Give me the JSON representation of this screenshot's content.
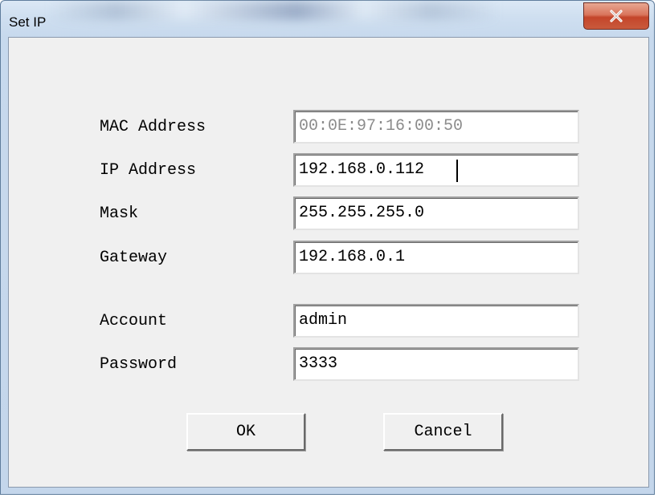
{
  "window": {
    "title": "Set IP",
    "close_label": "x"
  },
  "form": {
    "mac_label": "MAC Address",
    "mac_value": "00:0E:97:16:00:50",
    "ip_label": "IP Address",
    "ip_value": "192.168.0.112",
    "mask_label": "Mask",
    "mask_value": "255.255.255.0",
    "gateway_label": "Gateway",
    "gateway_value": "192.168.0.1",
    "account_label": "Account",
    "account_value": "admin",
    "password_label": "Password",
    "password_value": "3333"
  },
  "buttons": {
    "ok": "OK",
    "cancel": "Cancel"
  },
  "icons": {
    "close": "close-icon"
  },
  "colors": {
    "close_button": "#c4452a",
    "titlebar": "#c4d6eb"
  }
}
